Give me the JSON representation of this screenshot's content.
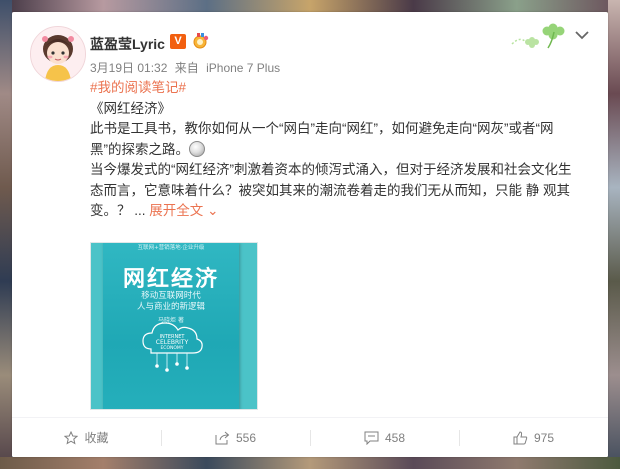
{
  "post": {
    "username": "蓝盈莹Lyric",
    "vip_badge": "V",
    "date": "3月19日 01:32",
    "source_prefix": "来自",
    "source": "iPhone 7 Plus",
    "topic": "#我的阅读笔记#",
    "lines": [
      "《网红经济》",
      "此书是工具书，教你如何从一个“网白”走向“网红”，如何避免走向“网灰”或者“网",
      "黑”的探索之路。",
      "当今爆发式的“网红经济”刺激着资本的倾泻式涌入，但对于经济发展和社会文化生",
      "态而言，它意味着什么？被突如其来的潮流卷着走的我们无从而知，只能 静 观其",
      "变。？"
    ],
    "ellipsis": "...",
    "expand_label": "展开全文",
    "expand_chevron": "⌄"
  },
  "book": {
    "title": "网红经济",
    "subtitle_line1": "移动互联网时代",
    "subtitle_line2": "人与商业的新逻辑",
    "author": "马晓炬 著",
    "center_line1": "INTERNET",
    "center_line2": "CELEBRITY",
    "center_line3": "ECONOMY",
    "publisher_note": "互联网+营销落地·企业升级"
  },
  "actions": {
    "favorite_label": "收藏",
    "repost_count": "556",
    "comment_count": "458",
    "like_count": "975"
  },
  "colors": {
    "accent": "#eb7350",
    "vip": "#f25f0f",
    "book_cover": "#25afbb"
  },
  "icons": {
    "favorite": "star-outline-icon",
    "repost": "share-arrow-icon",
    "comment": "comment-bubble-icon",
    "like": "thumbs-up-icon",
    "more": "chevron-down-icon"
  }
}
